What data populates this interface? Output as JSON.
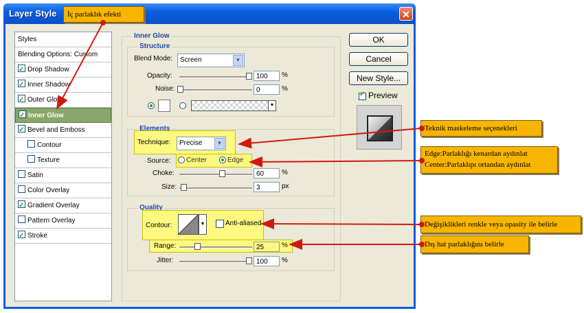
{
  "window": {
    "title": "Layer Style",
    "close_glyph": "✕"
  },
  "styles_list": [
    {
      "label": "Styles",
      "checkbox": false
    },
    {
      "label": "Blending Options: Custom",
      "checkbox": false
    },
    {
      "label": "Drop Shadow",
      "checkbox": true,
      "checked": true
    },
    {
      "label": "Inner Shadow",
      "checkbox": true,
      "checked": true
    },
    {
      "label": "Outer Glow",
      "checkbox": true,
      "checked": true
    },
    {
      "label": "Inner Glow",
      "checkbox": true,
      "checked": true,
      "selected": true
    },
    {
      "label": "Bevel and Emboss",
      "checkbox": true,
      "checked": true
    },
    {
      "label": "Contour",
      "checkbox": true,
      "checked": false,
      "indent": true
    },
    {
      "label": "Texture",
      "checkbox": true,
      "checked": false,
      "indent": true
    },
    {
      "label": "Satin",
      "checkbox": true,
      "checked": false
    },
    {
      "label": "Color Overlay",
      "checkbox": true,
      "checked": false
    },
    {
      "label": "Gradient Overlay",
      "checkbox": true,
      "checked": true
    },
    {
      "label": "Pattern Overlay",
      "checkbox": true,
      "checked": false
    },
    {
      "label": "Stroke",
      "checkbox": true,
      "checked": true
    }
  ],
  "inner_glow": {
    "title": "Inner Glow",
    "structure": {
      "title": "Structure",
      "blend_mode_label": "Blend Mode:",
      "blend_mode": "Screen",
      "opacity_label": "Opacity:",
      "opacity": "100",
      "opacity_unit": "%",
      "noise_label": "Noise:",
      "noise": "0",
      "noise_unit": "%"
    },
    "elements": {
      "title": "Elements",
      "technique_label": "Technique:",
      "technique": "Precise",
      "source_label": "Source:",
      "source_center": "Center",
      "source_edge": "Edge",
      "choke_label": "Choke:",
      "choke": "60",
      "choke_unit": "%",
      "size_label": "Size:",
      "size": "3",
      "size_unit": "px"
    },
    "quality": {
      "title": "Quality",
      "contour_label": "Contour:",
      "anti_aliased": "Anti-aliased",
      "range_label": "Range:",
      "range": "25",
      "range_unit": "%",
      "jitter_label": "Jitter:",
      "jitter": "100",
      "jitter_unit": "%"
    }
  },
  "buttons": {
    "ok": "OK",
    "cancel": "Cancel",
    "new_style": "New Style...",
    "preview": "Preview"
  },
  "callouts": {
    "inner_glow_effect": "İç parlaklık efekti",
    "technique": "Teknik maskeleme seçenekleri",
    "source_line1": "Edge:Parlaklığı kenardan aydınlat",
    "source_line2": "Center:Parlaklıpı ortandan aydınlat",
    "contour": "Değişiklikleri renkle veya opasity ile belirle",
    "range": "Dış hat parlaklığını belirle"
  },
  "colors": {
    "highlight": "#fdf880",
    "callout": "#f7b500",
    "arrow": "#d01a10",
    "section_title": "#1f4aa8"
  }
}
